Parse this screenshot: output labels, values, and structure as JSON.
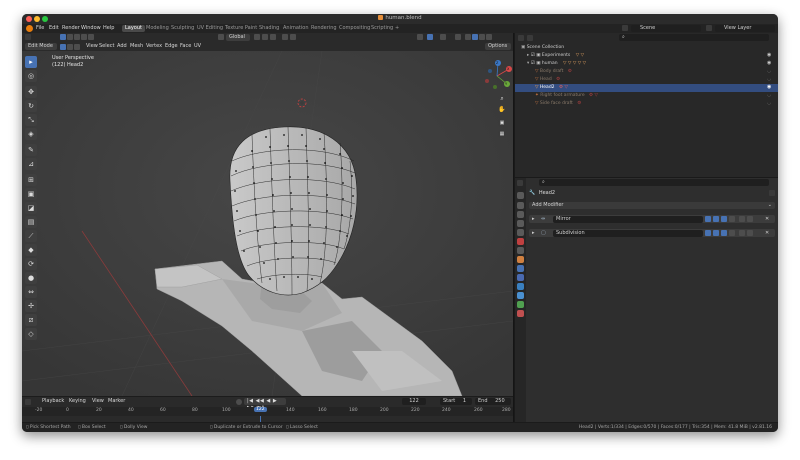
{
  "window": {
    "title": "human.blend"
  },
  "menubar": {
    "menus": [
      "File",
      "Edit",
      "Render",
      "Window",
      "Help"
    ],
    "workspaces": [
      "Layout",
      "Modeling",
      "Sculpting",
      "UV Editing",
      "Texture Paint",
      "Shading",
      "Animation",
      "Rendering",
      "Compositing",
      "Scripting"
    ],
    "active_workspace": "Layout",
    "add_tab": "+",
    "scene_label": "Scene",
    "view_layer_label": "View Layer"
  },
  "viewport_header": {
    "mode": "Edit Mode",
    "menus": [
      "View",
      "Select",
      "Add",
      "Mesh",
      "Vertex",
      "Edge",
      "Face",
      "UV"
    ],
    "orientation": "Global",
    "options_label": "Options"
  },
  "viewport": {
    "perspective_label": "User Perspective",
    "object_label": "(122) Head2",
    "gizmo_axes": [
      "X",
      "Y",
      "Z"
    ]
  },
  "tools": [
    "select-box",
    "cursor",
    "move",
    "rotate",
    "scale",
    "transform",
    "annotate",
    "measure",
    "extrude",
    "inset",
    "bevel",
    "loop-cut",
    "knife",
    "poly-build",
    "spin",
    "smooth",
    "edge-slide",
    "shrink-fatten",
    "shear",
    "rip"
  ],
  "timeline": {
    "menus": [
      "Playback",
      "Keying",
      "View",
      "Marker"
    ],
    "current_frame": "122",
    "start_label": "Start",
    "start": "1",
    "end_label": "End",
    "end": "250",
    "ticks": [
      "-20",
      "0",
      "20",
      "40",
      "60",
      "80",
      "100",
      "120",
      "140",
      "160",
      "180",
      "200",
      "220",
      "240",
      "260",
      "280"
    ],
    "cursor_frame": "122"
  },
  "outliner": {
    "search_placeholder": "",
    "root": "Scene Collection",
    "rows": [
      {
        "label": "Experiments",
        "depth": 1,
        "state": "normal"
      },
      {
        "label": "human",
        "depth": 1,
        "state": "normal"
      },
      {
        "label": "Body draft",
        "depth": 2,
        "state": "dim"
      },
      {
        "label": "Head",
        "depth": 2,
        "state": "dim"
      },
      {
        "label": "Head2",
        "depth": 2,
        "state": "selected"
      },
      {
        "label": "Right foot armature",
        "depth": 2,
        "state": "dim"
      },
      {
        "label": "Side face draft",
        "depth": 2,
        "state": "dim"
      }
    ]
  },
  "properties": {
    "object_name": "Head2",
    "add_modifier_label": "Add Modifier",
    "modifiers": [
      {
        "name": "Mirror"
      },
      {
        "name": "Subdivision"
      }
    ]
  },
  "statusbar": {
    "items": [
      "Pick Shortest Path",
      "Box Select",
      "Dolly View",
      "Duplicate or Extrude to Cursor",
      "Lasso Select"
    ],
    "stats": "Head2 | Verts:1/334 | Edges:0/570 | Faces:0/177 | Tris:354 | Mem: 41.8 MiB | v2.81.16"
  },
  "colors": {
    "accent": "#4772b3",
    "blender_orange": "#e87d0d",
    "selected_row": "#334d80",
    "viewport_bg": "#3d3d3d",
    "header_bg": "#2a2a2a"
  }
}
